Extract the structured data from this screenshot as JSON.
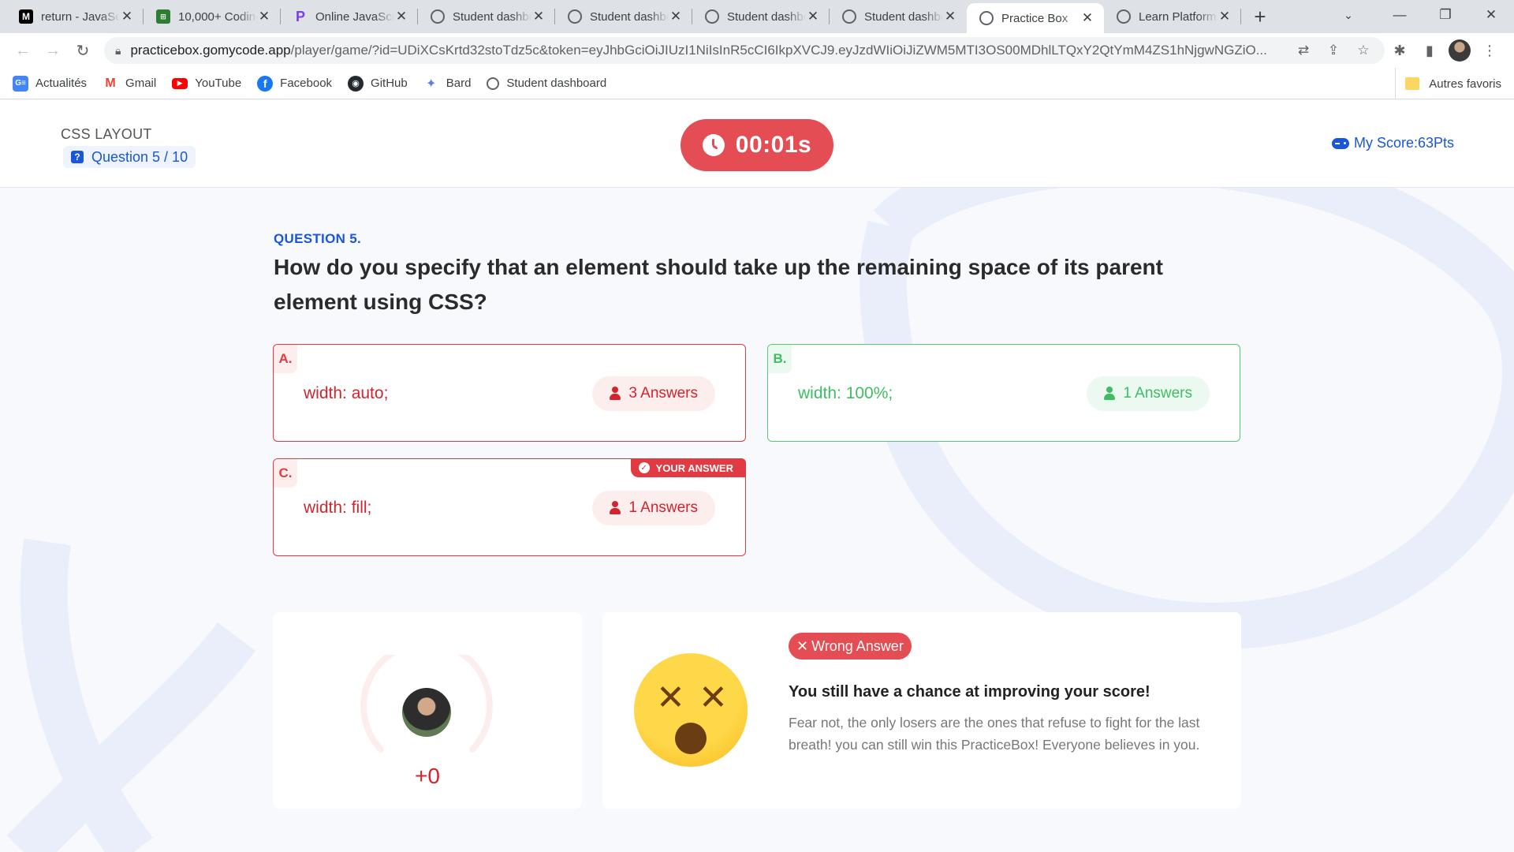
{
  "browser": {
    "tabs": [
      {
        "title": "return - JavaScript",
        "icon": "M",
        "active": false
      },
      {
        "title": "10,000+ Coding",
        "icon": "10k",
        "active": false
      },
      {
        "title": "Online JavaScript",
        "icon": "P",
        "active": false
      },
      {
        "title": "Student dashboard",
        "icon": "globe",
        "active": false
      },
      {
        "title": "Student dashboard",
        "icon": "globe",
        "active": false
      },
      {
        "title": "Student dashboard",
        "icon": "globe",
        "active": false
      },
      {
        "title": "Student dashboard",
        "icon": "globe",
        "active": false
      },
      {
        "title": "Practice Box",
        "icon": "globe",
        "active": true
      },
      {
        "title": "Learn Platform",
        "icon": "globe",
        "active": false
      }
    ],
    "url_host": "practicebox.gomycode.app",
    "url_path": "/player/game/?id=UDiXCsKrtd32stoTdz5c&token=eyJhbGciOiJIUzI1NiIsInR5cCI6IkpXVCJ9.eyJzdWIiOiJiZWM5MTI3OS00MDhlLTQxY2QtYmM4ZS1hNjgwNGZiO...",
    "bookmarks": [
      "Actualités",
      "Gmail",
      "YouTube",
      "Facebook",
      "GitHub",
      "Bard",
      "Student dashboard"
    ],
    "other_bookmarks": "Autres favoris"
  },
  "header": {
    "section_title": "CSS LAYOUT",
    "question_counter": "Question 5 / 10",
    "timer": "00:01s",
    "score": "My Score:63Pts"
  },
  "question": {
    "label": "QUESTION 5.",
    "text": "How do you specify that an element should take up the remaining space of its parent element using CSS?"
  },
  "options": [
    {
      "letter": "A.",
      "text": "width: auto;",
      "answers": "3 Answers",
      "state": "wrong"
    },
    {
      "letter": "B.",
      "text": "width: 100%;",
      "answers": "1 Answers",
      "state": "correct"
    },
    {
      "letter": "C.",
      "text": "width: fill;",
      "answers": "1 Answers",
      "state": "wrong",
      "tag": "YOUR ANSWER"
    }
  ],
  "result": {
    "points": "+0",
    "badge": "Wrong Answer",
    "title": "You still have a chance at improving your score!",
    "message": "Fear not, the only losers are the ones that refuse to fight for the last breath! you can still win this PracticeBox! Everyone believes in you."
  },
  "colors": {
    "accent_blue": "#1a56db",
    "wrong_red": "#e23a43",
    "correct_green": "#57c978",
    "timer_red": "#e54d55"
  }
}
